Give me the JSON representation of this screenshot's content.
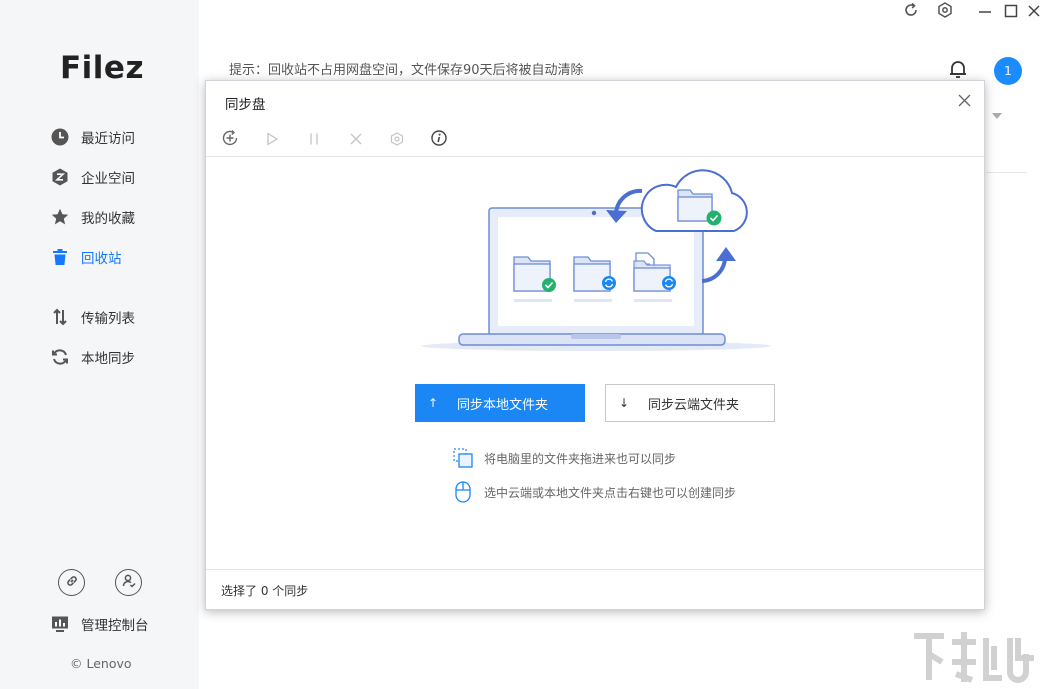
{
  "app": {
    "logo": "Filez",
    "copyright": "© Lenovo"
  },
  "sidebar": {
    "items": [
      {
        "label": "最近访问",
        "icon": "clock-icon"
      },
      {
        "label": "企业空间",
        "icon": "enterprise-hex-icon"
      },
      {
        "label": "我的收藏",
        "icon": "star-icon"
      },
      {
        "label": "回收站",
        "icon": "trash-icon",
        "active": true
      },
      {
        "label": "传输列表",
        "icon": "transfer-arrows-icon"
      },
      {
        "label": "本地同步",
        "icon": "sync-icon"
      }
    ],
    "admin_label": "管理控制台"
  },
  "header": {
    "hint": "提示：回收站不占用网盘空间，文件保存90天后将被自动清除",
    "avatar_text": "1"
  },
  "dialog": {
    "title": "同步盘",
    "toolbar": [
      "add-sync",
      "start",
      "pause",
      "delete",
      "settings",
      "info"
    ],
    "buttons": {
      "sync_local": {
        "arrow": "↑",
        "label": "同步本地文件夹"
      },
      "sync_cloud": {
        "arrow": "↓",
        "label": "同步云端文件夹"
      }
    },
    "tips": [
      "将电脑里的文件夹拖进来也可以同步",
      "选中云端或本地文件夹点击右键也可以创建同步"
    ],
    "footer": "选择了 0 个同步"
  },
  "colors": {
    "accent": "#1a87f5",
    "illustration": "#4a6fd0",
    "success": "#23b26d",
    "sidebar_bg": "#f5f6f7"
  }
}
